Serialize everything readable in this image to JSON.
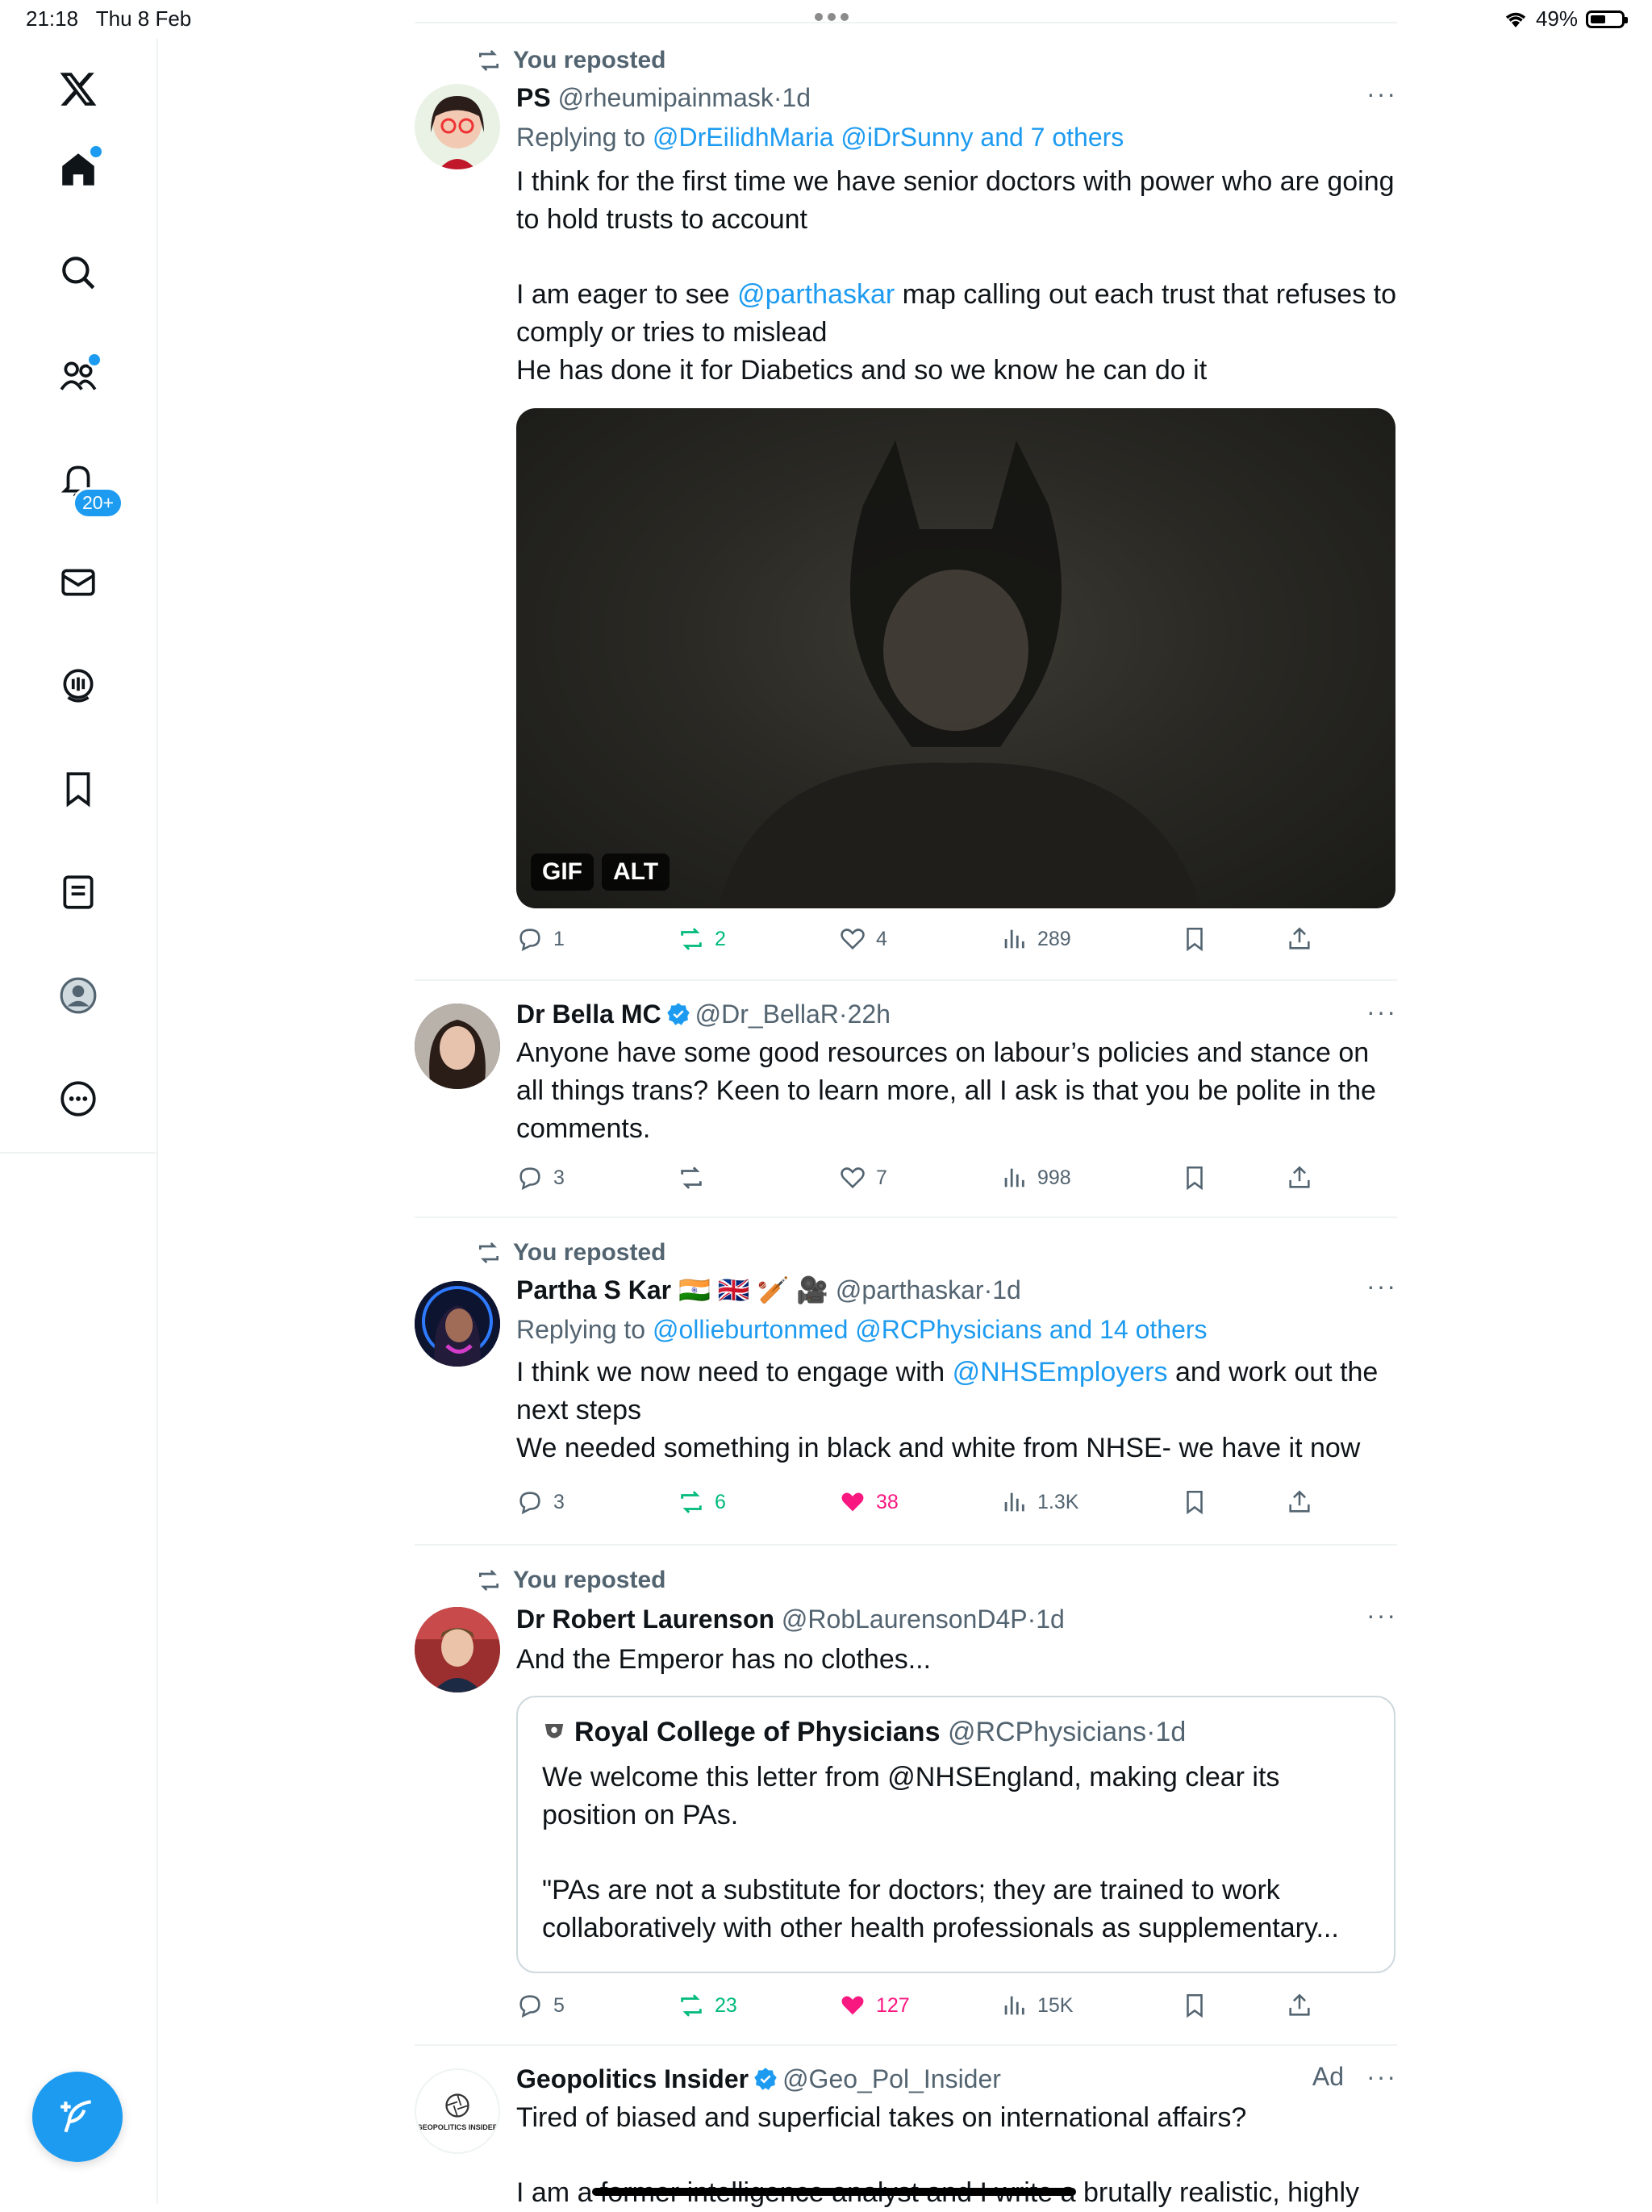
{
  "status_bar": {
    "time": "21:18",
    "date": "Thu 8 Feb",
    "battery": "49%",
    "battery_level": 0.49
  },
  "sidebar": {
    "logo_icon": "x-logo-icon",
    "items": [
      {
        "name": "home",
        "icon": "home-icon"
      },
      {
        "name": "explore",
        "icon": "search-icon"
      },
      {
        "name": "communities",
        "icon": "communities-icon"
      },
      {
        "name": "notifications",
        "icon": "bell-icon",
        "badge": "20+"
      },
      {
        "name": "messages",
        "icon": "mail-icon"
      },
      {
        "name": "spaces",
        "icon": "spaces-icon"
      },
      {
        "name": "bookmarks",
        "icon": "bookmark-icon"
      },
      {
        "name": "lists",
        "icon": "list-icon"
      },
      {
        "name": "profile",
        "icon": "profile-icon"
      },
      {
        "name": "more",
        "icon": "more-circle-icon"
      }
    ],
    "compose_icon": "compose-icon"
  },
  "tweets": [
    {
      "repost_label": "You reposted",
      "name": "PS",
      "handle": "@rheumipainmask",
      "sep": "·",
      "time": "1d",
      "replying_prefix": "Replying to",
      "replying_to": "@DrEilidhMaria @iDrSunny and 7 others",
      "text_1": "I think for the first time we have senior doctors with power who are going to hold trusts to account",
      "text_2a": "I am eager to see",
      "mention": "@parthaskar",
      "text_2b": "map calling out each trust that refuses to comply or tries to mislead",
      "text_3": "He has done it for Diabetics and so we know he can do it",
      "media": {
        "gif": "GIF",
        "alt": "ALT"
      },
      "stats": {
        "replies": "1",
        "reposts": "2",
        "likes": "4",
        "views": "289"
      }
    },
    {
      "name": "Dr Bella MC",
      "handle": "@Dr_BellaR",
      "sep": "·",
      "time": "22h",
      "text": "Anyone have some good resources on labour’s policies and stance on all things trans? Keen to learn more, all I ask is that you be polite in the comments.",
      "stats": {
        "replies": "3",
        "reposts": "",
        "likes": "7",
        "views": "998"
      }
    },
    {
      "repost_label": "You reposted",
      "name": "Partha S Kar",
      "name_emoji": "🇮🇳 🇬🇧 🏏 🎥",
      "handle": "@parthaskar",
      "sep": "·",
      "time": "1d",
      "replying_prefix": "Replying to",
      "replying_to": "@ollieburtonmed @RCPhysicians and 14 others",
      "text_1a": "I think we now need to engage with",
      "mention": "@NHSEmployers",
      "text_1b": "and work out the next steps",
      "text_2": "We needed something in black and white from NHSE- we have it now",
      "stats": {
        "replies": "3",
        "reposts": "6",
        "likes": "38",
        "views": "1.3K"
      }
    },
    {
      "repost_label": "You reposted",
      "name": "Dr Robert Laurenson",
      "handle": "@RobLaurensonD4P",
      "sep": "·",
      "time": "1d",
      "text": "And the Emperor has no clothes...",
      "quote": {
        "name": "Royal College of Physicians",
        "handle": "@RCPhysicians",
        "sep": "·",
        "time": "1d",
        "text_1": "We welcome this letter from @NHSEngland, making clear its position on PAs.",
        "text_2": "\"PAs are not a substitute for doctors; they are trained to work collaboratively with other health professionals as supplementary..."
      },
      "stats": {
        "replies": "5",
        "reposts": "23",
        "likes": "127",
        "views": "15K"
      }
    },
    {
      "name": "Geopolitics Insider",
      "handle": "@Geo_Pol_Insider",
      "ad_label": "Ad",
      "avatar_text": "GEOPOLITICS INSIDER",
      "text_1": "Tired of biased and superficial takes on international affairs?",
      "text_2": "I am a former intelligence analyst and I write a brutally realistic, highly"
    }
  ],
  "colors": {
    "accent": "#1d9bf0",
    "repost_green": "#00ba7c",
    "like_pink": "#f91880",
    "muted": "#536471"
  }
}
